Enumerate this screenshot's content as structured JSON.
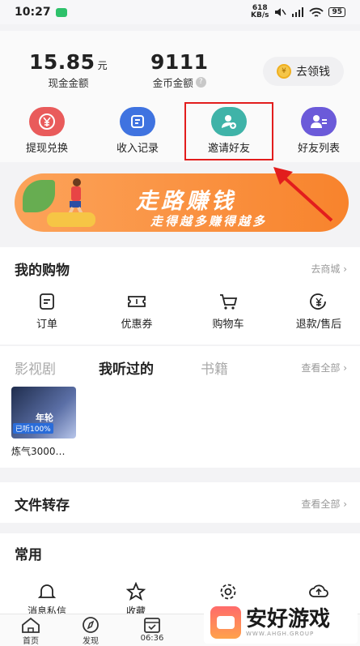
{
  "status_bar": {
    "time": "10:27",
    "speed_top": "618",
    "speed_bottom": "KB/s",
    "battery": "95"
  },
  "balance": {
    "cash_value": "15.85",
    "cash_unit": "元",
    "cash_label": "现金金额",
    "coin_value": "9111",
    "coin_label": "金币金额",
    "help_mark": "?",
    "earn_button": "去领钱",
    "coin_glyph": "¥"
  },
  "actions": [
    {
      "label": "提现兑换",
      "color": "#e95b5b",
      "icon": "yen-icon"
    },
    {
      "label": "收入记录",
      "color": "#3f73e0",
      "icon": "record-icon"
    },
    {
      "label": "邀请好友",
      "color": "#3fb3a8",
      "icon": "invite-user-icon"
    },
    {
      "label": "好友列表",
      "color": "#6b5ad9",
      "icon": "friend-list-icon"
    }
  ],
  "banner": {
    "title": "走路赚钱",
    "subtitle": "走得越多赚得越多"
  },
  "shopping": {
    "title": "我的购物",
    "link": "去商城 ›",
    "items": [
      {
        "label": "订单",
        "icon": "order-icon"
      },
      {
        "label": "优惠券",
        "icon": "coupon-icon"
      },
      {
        "label": "购物车",
        "icon": "cart-icon"
      },
      {
        "label": "退款/售后",
        "icon": "refund-icon"
      }
    ]
  },
  "media": {
    "tabs": [
      "影视剧",
      "我听过的",
      "书籍"
    ],
    "active_tab": "我听过的",
    "link": "查看全部 ›",
    "item": {
      "badge": "已听100%",
      "title_art": "年轮",
      "caption": "炼气3000…"
    }
  },
  "files": {
    "title": "文件转存",
    "link": "查看全部 ›"
  },
  "common": {
    "title": "常用",
    "items": [
      {
        "label": "消息私信",
        "icon": "bell-icon"
      },
      {
        "label": "收藏",
        "icon": "star-icon"
      },
      {
        "label": "设置",
        "icon": "gear-icon"
      },
      {
        "label": "上传",
        "icon": "cloud-upload-icon"
      }
    ]
  },
  "bottom_nav": [
    {
      "label": "首页",
      "icon": "home-icon"
    },
    {
      "label": "发现",
      "icon": "compass-icon"
    },
    {
      "label": "06:36",
      "icon": "calendar-check-icon"
    }
  ],
  "watermark": {
    "text": "安好游戏",
    "sub": "WWW.AHGH.GROUP"
  },
  "colors": {
    "highlight": "#e21d1d",
    "banner": "#f8832c",
    "accent_green": "#2ec16b"
  }
}
